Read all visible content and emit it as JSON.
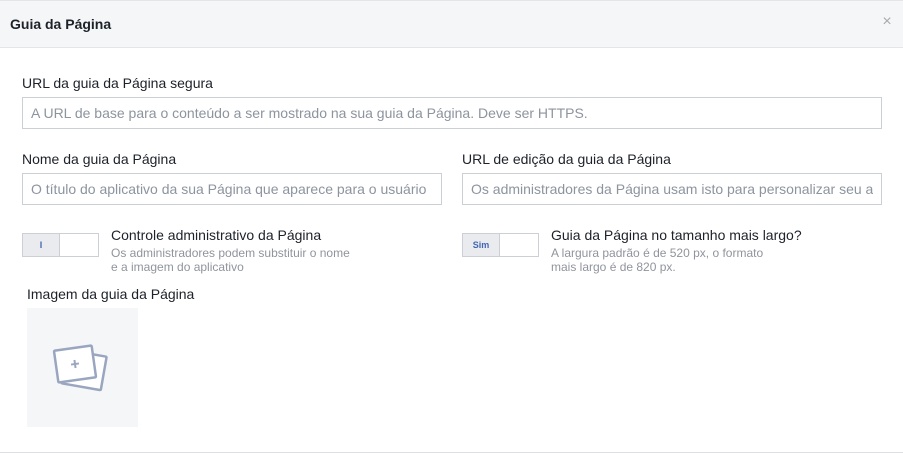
{
  "header": {
    "title": "Guia da Página",
    "close_label": "×"
  },
  "secure_url": {
    "label": "URL da guia da Página segura",
    "placeholder": "A URL de base para o conteúdo a ser mostrado na sua guia da Página. Deve ser HTTPS.",
    "value": ""
  },
  "tab_name": {
    "label": "Nome da guia da Página",
    "placeholder": "O título do aplicativo da sua Página que aparece para o usuário",
    "value": ""
  },
  "edit_url": {
    "label": "URL de edição da guia da Página",
    "placeholder": "Os administradores da Página usam isto para personalizar seu aplicativo",
    "value": ""
  },
  "admin_control": {
    "toggle_label": "I",
    "title": "Controle administrativo da Página",
    "desc_line1": "Os administradores podem substituir o nome",
    "desc_line2": "e a imagem do aplicativo"
  },
  "wide_tab": {
    "toggle_label": "Sim",
    "title": "Guia da Página no tamanho mais largo?",
    "desc_line1": "A largura padrão é de 520 px, o formato",
    "desc_line2": "mais largo é de 820 px."
  },
  "tab_image": {
    "label": "Imagem da guia da Página",
    "icon": "add-photo-icon"
  },
  "colors": {
    "header_bg": "#f5f6f7",
    "border": "#ccd0d5",
    "placeholder": "#8d949e",
    "accent": "#4267b2",
    "secondary_text": "#90949c"
  }
}
